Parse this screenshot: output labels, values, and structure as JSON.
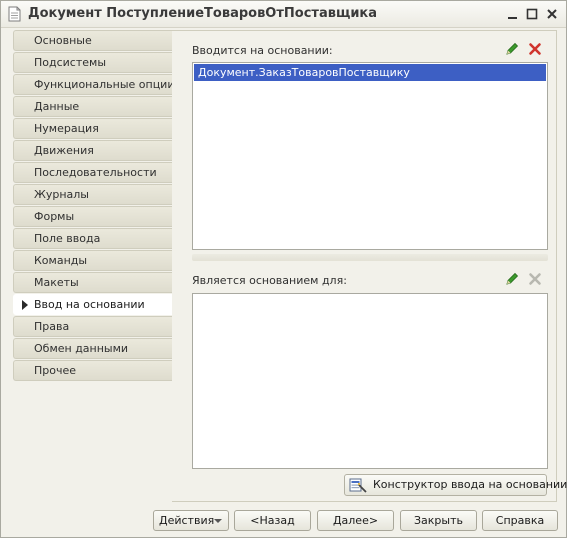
{
  "window": {
    "title": "Документ ПоступлениеТоваровОтПоставщика",
    "icons": [
      "document-icon",
      "minimize-icon",
      "maximize-icon",
      "close-icon"
    ]
  },
  "tabs": [
    {
      "label": "Основные",
      "active": false
    },
    {
      "label": "Подсистемы",
      "active": false
    },
    {
      "label": "Функциональные опции",
      "active": false
    },
    {
      "label": "Данные",
      "active": false
    },
    {
      "label": "Нумерация",
      "active": false
    },
    {
      "label": "Движения",
      "active": false
    },
    {
      "label": "Последовательности",
      "active": false
    },
    {
      "label": "Журналы",
      "active": false
    },
    {
      "label": "Формы",
      "active": false
    },
    {
      "label": "Поле ввода",
      "active": false
    },
    {
      "label": "Команды",
      "active": false
    },
    {
      "label": "Макеты",
      "active": false
    },
    {
      "label": "Ввод на основании",
      "active": true
    },
    {
      "label": "Права",
      "active": false
    },
    {
      "label": "Обмен данными",
      "active": false
    },
    {
      "label": "Прочее",
      "active": false
    }
  ],
  "based_on": {
    "label": "Вводится на основании:",
    "items": [
      "Документ.ЗаказТоваровПоставщику"
    ]
  },
  "basis_for": {
    "label": "Является основанием для:",
    "items": []
  },
  "constructor_button": "Конструктор ввода на основании",
  "footer": {
    "actions": "Действия",
    "back": "<Назад",
    "next": "Далее>",
    "close": "Закрыть",
    "help": "Справка"
  },
  "colors": {
    "selection": "#3d5fc4",
    "edit_icon": "#3c9a2c",
    "delete_icon": "#d0342c",
    "disabled_icon": "#b8b8b0"
  }
}
